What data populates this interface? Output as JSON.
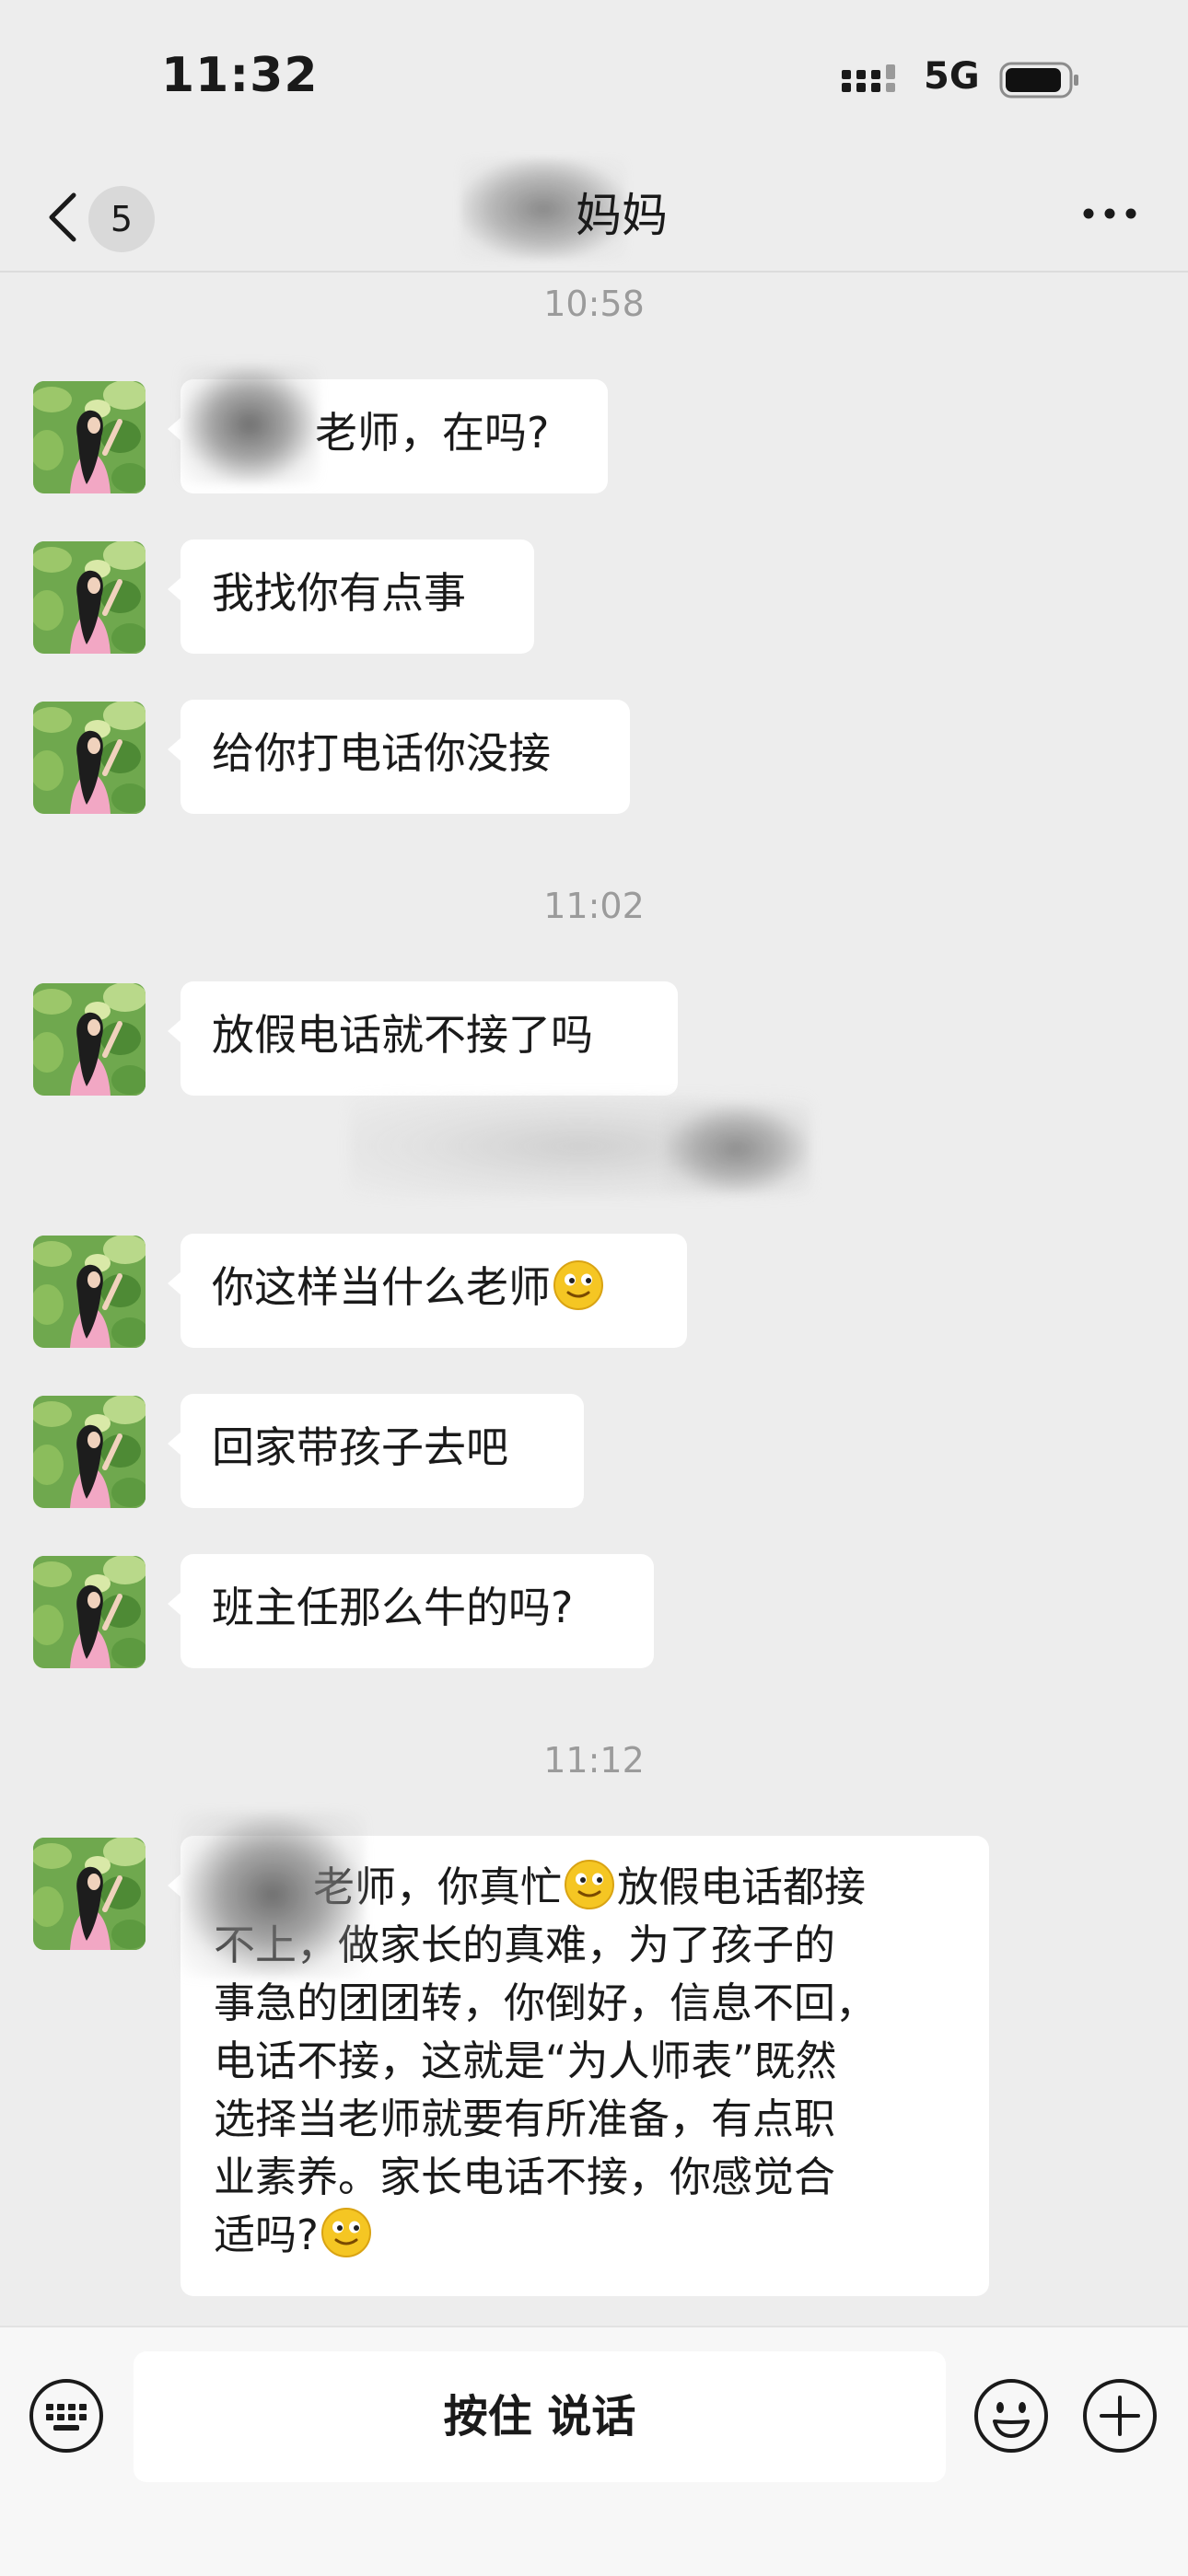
{
  "status_bar": {
    "time": "11:32",
    "network": "5G",
    "icons": [
      "signal-icon",
      "battery-icon"
    ]
  },
  "nav": {
    "back_badge": "5",
    "title": "妈妈",
    "icons": [
      "chevron-left-icon",
      "more-icon"
    ]
  },
  "messages": [
    {
      "type": "time",
      "text": "10:58"
    },
    {
      "type": "msg",
      "text": "老师，在吗?"
    },
    {
      "type": "msg",
      "text": "我找你有点事"
    },
    {
      "type": "msg",
      "text": "给你打电话你没接"
    },
    {
      "type": "time",
      "text": "11:02"
    },
    {
      "type": "msg",
      "text": "放假电话就不接了吗"
    },
    {
      "type": "msg",
      "text": "你这样当什么老师"
    },
    {
      "type": "msg",
      "text": "回家带孩子去吧"
    },
    {
      "type": "msg",
      "text": "班主任那么牛的吗?"
    },
    {
      "type": "time",
      "text": "11:12"
    },
    {
      "type": "msg",
      "lines": [
        "老师，你真忙",
        "放假电话都接",
        "不上，做家长的真难，为了孩子的",
        "事急的团团转，你倒好，信息不回，",
        "电话不接，这就是“为人师表”既然",
        "选择当老师就要有所准备，有点职",
        "业素养。家长电话不接，你感觉合",
        "适吗?"
      ]
    }
  ],
  "input_bar": {
    "hold_to_talk": "按住 说话",
    "icons": [
      "keyboard-icon",
      "emoji-icon",
      "plus-icon"
    ]
  },
  "colors": {
    "background": "#ededed",
    "bubble": "#ffffff",
    "timestamp": "#9b9b9b",
    "input_bar": "#f7f7f7"
  }
}
